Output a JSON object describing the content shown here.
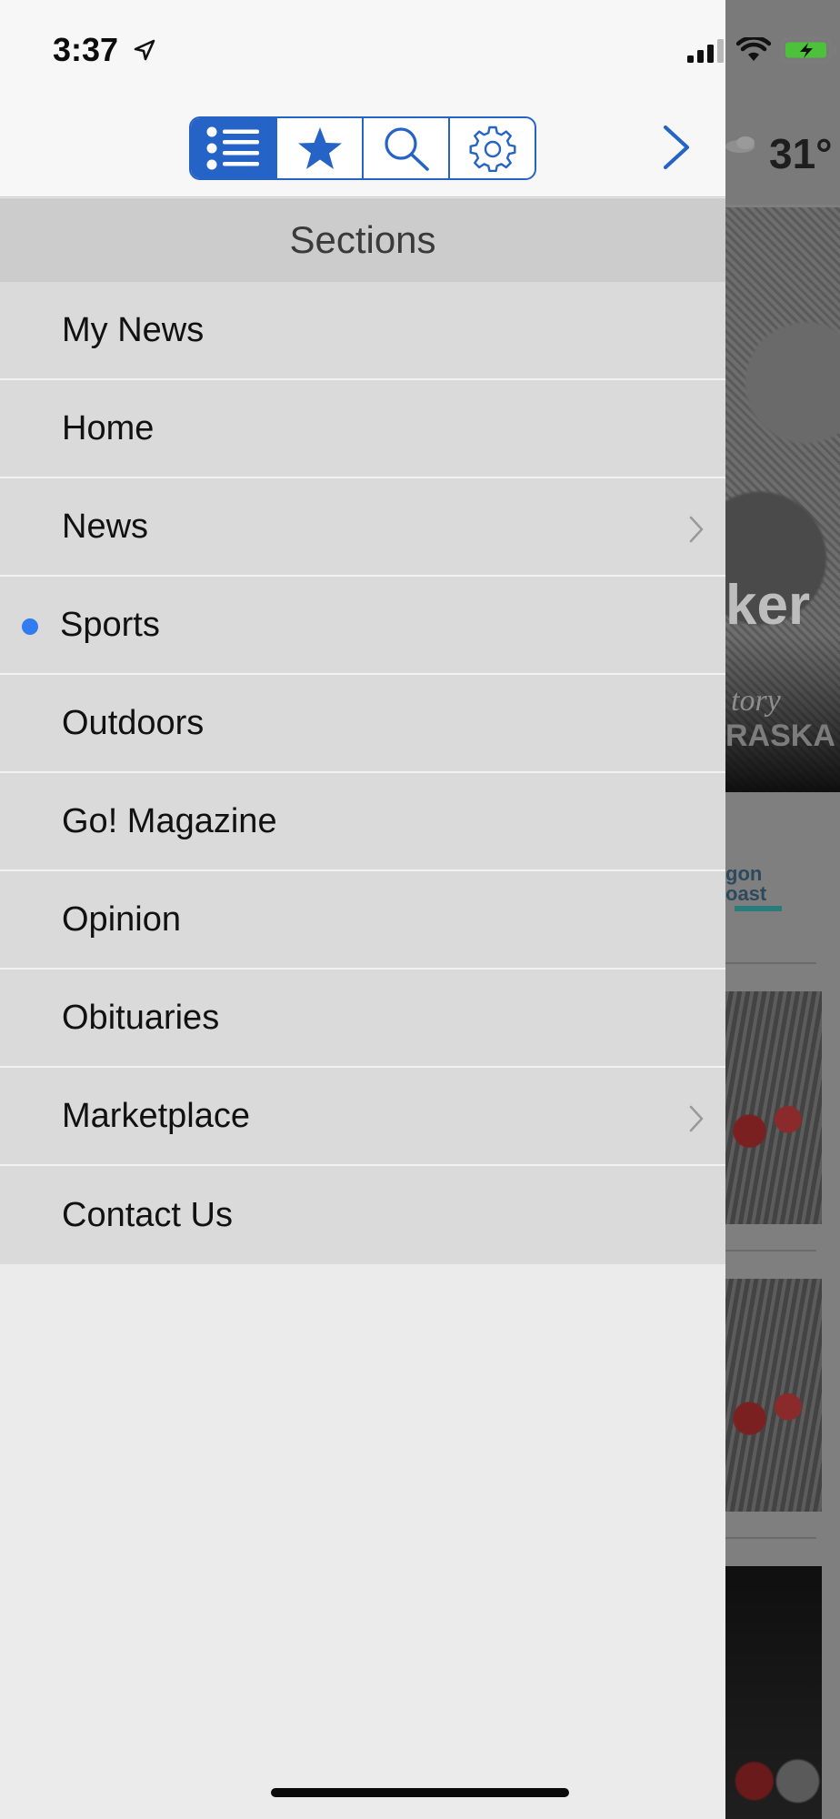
{
  "status_bar": {
    "time": "3:37"
  },
  "toolbar": {
    "segments": [
      {
        "name": "sections",
        "icon": "list-icon",
        "active": true
      },
      {
        "name": "favorites",
        "icon": "star-icon",
        "active": false
      },
      {
        "name": "search",
        "icon": "search-icon",
        "active": false
      },
      {
        "name": "settings",
        "icon": "gear-icon",
        "active": false
      }
    ],
    "next_icon": "chevron-right-icon"
  },
  "sections": {
    "title": "Sections",
    "items": [
      {
        "label": "My News"
      },
      {
        "label": "Home"
      },
      {
        "label": "News",
        "has_children": true
      },
      {
        "label": "Sports",
        "selected": true
      },
      {
        "label": "Outdoors"
      },
      {
        "label": "Go! Magazine"
      },
      {
        "label": "Opinion"
      },
      {
        "label": "Obituaries"
      },
      {
        "label": "Marketplace",
        "has_children": true
      },
      {
        "label": "Contact Us"
      }
    ]
  },
  "background_page": {
    "temperature": "31°",
    "hero_text": "ker",
    "hero_sub": "tory",
    "hero_sub2": "RASKA",
    "sponsor_line1": "gon",
    "sponsor_line2": "oast"
  },
  "colors": {
    "accent": "#2563c7",
    "selected_dot": "#2f7df0",
    "list_bg": "#dadada",
    "header_bg": "#cccccc"
  }
}
